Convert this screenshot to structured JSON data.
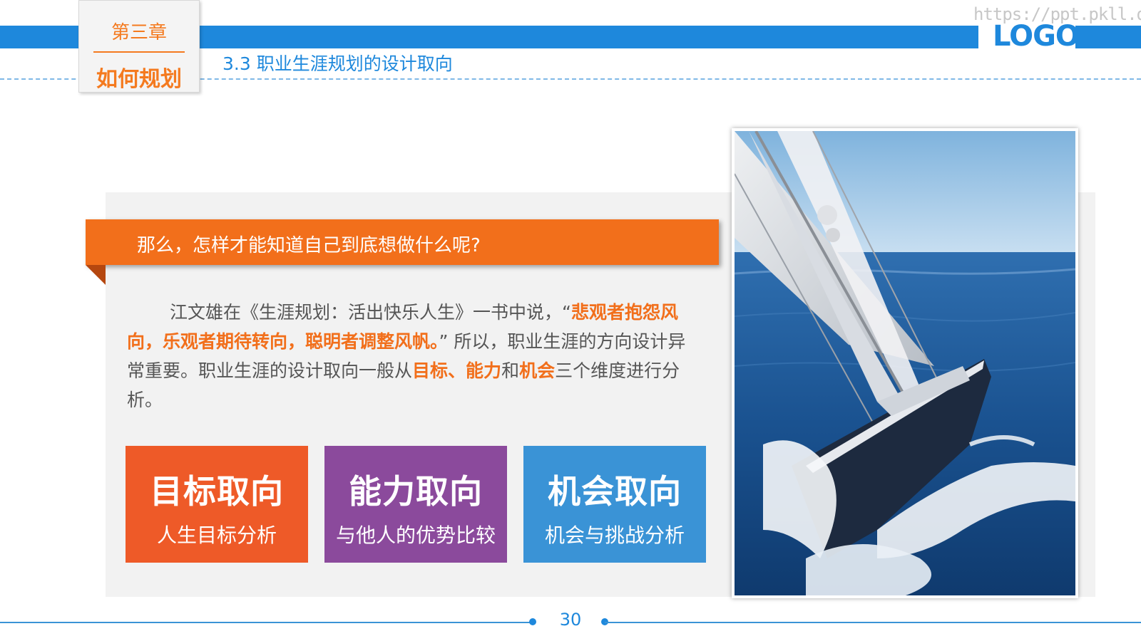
{
  "header": {
    "chapter_number": "第三章",
    "chapter_title": "如何规划",
    "section_title": "3.3 职业生涯规划的设计取向",
    "url": "https://ppt.pkll.de",
    "logo": "LOGO"
  },
  "main": {
    "question": "那么，怎样才能知道自己到底想做什么呢?",
    "paragraph": {
      "part1": "江文雄在《生涯规划：活出快乐人生》一书中说，“",
      "quote": "悲观者抱怨风向，乐观者期待转向，聪明者调整风帆。",
      "part2": "” 所以，职业生涯的方向设计异常重要。职业生涯的设计取向一般从",
      "hl_goal": "目标",
      "sep1": "、",
      "hl_ability": "能力",
      "sep2": "和",
      "hl_chance": "机会",
      "part3": "三个维度进行分析。"
    },
    "cards": [
      {
        "title": "目标取向",
        "subtitle": "人生目标分析",
        "color": "#ee5a28"
      },
      {
        "title": "能力取向",
        "subtitle": "与他人的优势比较",
        "color": "#8b4a9c"
      },
      {
        "title": "机会取向",
        "subtitle": "机会与挑战分析",
        "color": "#3a93d6"
      }
    ],
    "image": {
      "icon": "sailboat-photo"
    }
  },
  "footer": {
    "page_number": "30"
  },
  "colors": {
    "primary_blue": "#1e88dc",
    "accent_orange": "#f26f1b"
  }
}
